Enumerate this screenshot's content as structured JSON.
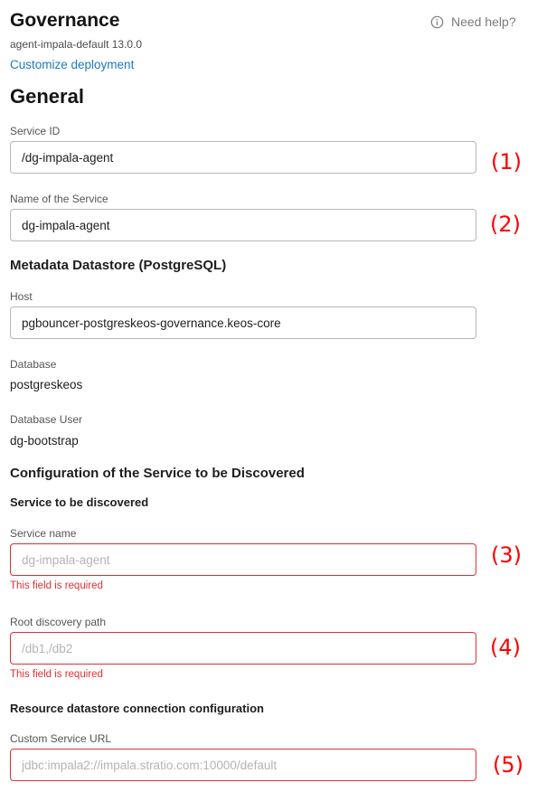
{
  "header": {
    "title": "Governance",
    "help_label": "Need help?",
    "subtitle": "agent-impala-default 13.0.0",
    "customize_link": "Customize deployment"
  },
  "general": {
    "heading": "General",
    "service_id": {
      "label": "Service ID",
      "value": "/dg-impala-agent"
    },
    "service_name": {
      "label": "Name of the Service",
      "value": "dg-impala-agent"
    }
  },
  "metadata": {
    "heading": "Metadata Datastore (PostgreSQL)",
    "host": {
      "label": "Host",
      "value": "pgbouncer-postgreskeos-governance.keos-core"
    },
    "database": {
      "label": "Database",
      "value": "postgreskeos"
    },
    "database_user": {
      "label": "Database User",
      "value": "dg-bootstrap"
    }
  },
  "discovery": {
    "heading": "Configuration of the Service to be Discovered",
    "subheading": "Service to be discovered",
    "service_name": {
      "label": "Service name",
      "value": "",
      "placeholder": "dg-impala-agent",
      "error": "This field is required"
    },
    "root_path": {
      "label": "Root discovery path",
      "value": "",
      "placeholder": "/db1,/db2",
      "error": "This field is required"
    },
    "resource_heading": "Resource datastore connection configuration",
    "custom_url": {
      "label": "Custom Service URL",
      "value": "",
      "placeholder": "jdbc:impala2://impala.stratio.com:10000/default"
    }
  },
  "annotations": [
    "(1)",
    "(2)",
    "(3)",
    "(4)",
    "(5)"
  ],
  "colors": {
    "error": "#e02f35",
    "link": "#1a7ac0",
    "annotation": "#ff0000"
  },
  "icons": {
    "help": "info-circle-icon"
  }
}
